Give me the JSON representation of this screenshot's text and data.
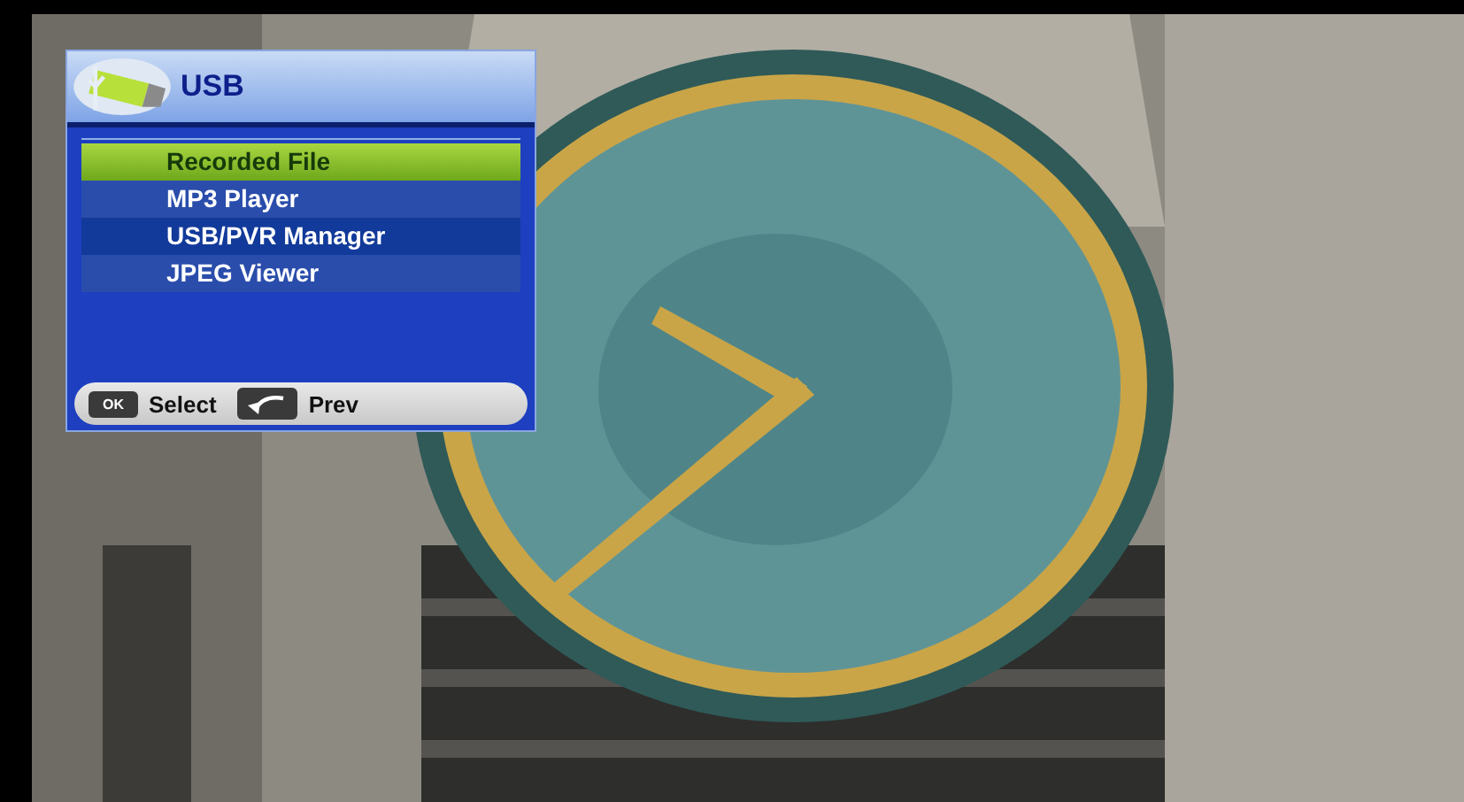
{
  "menu": {
    "title": "USB",
    "items": [
      {
        "label": "Recorded File",
        "selected": true
      },
      {
        "label": "MP3 Player",
        "selected": false
      },
      {
        "label": "USB/PVR Manager",
        "selected": false
      },
      {
        "label": "JPEG Viewer",
        "selected": false
      }
    ],
    "hints": [
      {
        "key": "OK",
        "kind": "key",
        "label": "Select"
      },
      {
        "kind": "back",
        "label": "Prev"
      }
    ]
  }
}
